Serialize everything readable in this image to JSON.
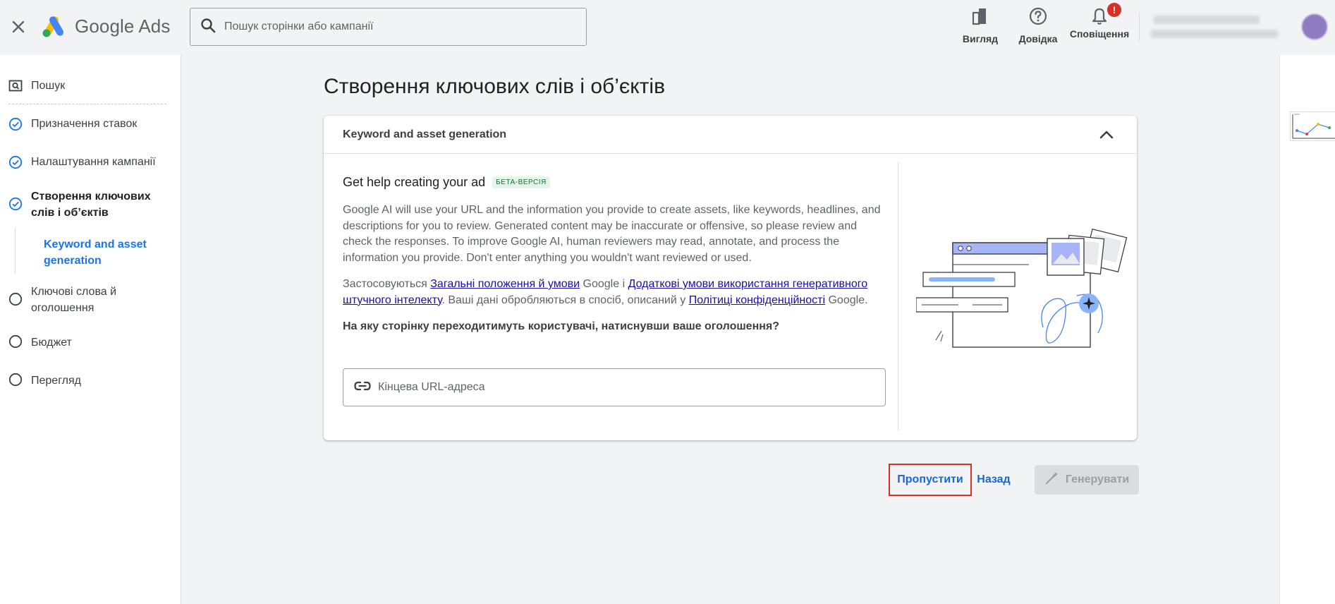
{
  "header": {
    "brand_google": "Google",
    "brand_ads": "Ads",
    "search_placeholder": "Пошук сторінки або кампанії",
    "view_label": "Вигляд",
    "help_label": "Довідка",
    "notifications_label": "Сповіщення",
    "notifications_badge": "!"
  },
  "sidebar": {
    "items": [
      {
        "label": "Пошук",
        "state": "search"
      },
      {
        "label": "Призначення ставок",
        "state": "done"
      },
      {
        "label": "Налаштування кампанії",
        "state": "done"
      },
      {
        "label": "Створення ключових слів і об’єктів",
        "state": "active"
      },
      {
        "label": "Ключові слова й оголошення",
        "state": "todo"
      },
      {
        "label": "Бюджет",
        "state": "todo"
      },
      {
        "label": "Перегляд",
        "state": "todo"
      }
    ],
    "subitem": "Keyword and asset generation"
  },
  "main": {
    "title": "Створення ключових слів і об’єктів",
    "card_title": "Keyword and asset generation",
    "help_title": "Get help creating your ad",
    "beta_badge": "БЕТА-ВЕРСІЯ",
    "description": "Google AI will use your URL and the information you provide to create assets, like keywords, headlines, and descriptions for you to review. Generated content may be inaccurate or offensive, so please review and check the responses. To improve Google AI, human reviewers may read, annotate, and process the information you provide. Don't enter anything you wouldn't want reviewed or used.",
    "terms_prefix": "Застосовуються ",
    "terms_link1": "Загальні положення й умови",
    "terms_mid1": " Google і ",
    "terms_link2": "Додаткові умови використання генеративного штучного інтелекту",
    "terms_mid2": ". Ваші дані обробляються в спосіб, описаний у ",
    "terms_link3": "Політиці конфіденційності",
    "terms_suffix": " Google.",
    "question": "На яку сторінку переходитимуть користувачі, натиснувши ваше оголошення?",
    "url_placeholder": "Кінцева URL-адреса"
  },
  "actions": {
    "skip": "Пропустити",
    "back": "Назад",
    "generate": "Генерувати"
  },
  "colors": {
    "accent": "#1a73e8",
    "link": "#1a0dab",
    "highlight": "#d93025",
    "beta_bg": "#e6f4ea",
    "illustration": "#8ab4f8"
  }
}
